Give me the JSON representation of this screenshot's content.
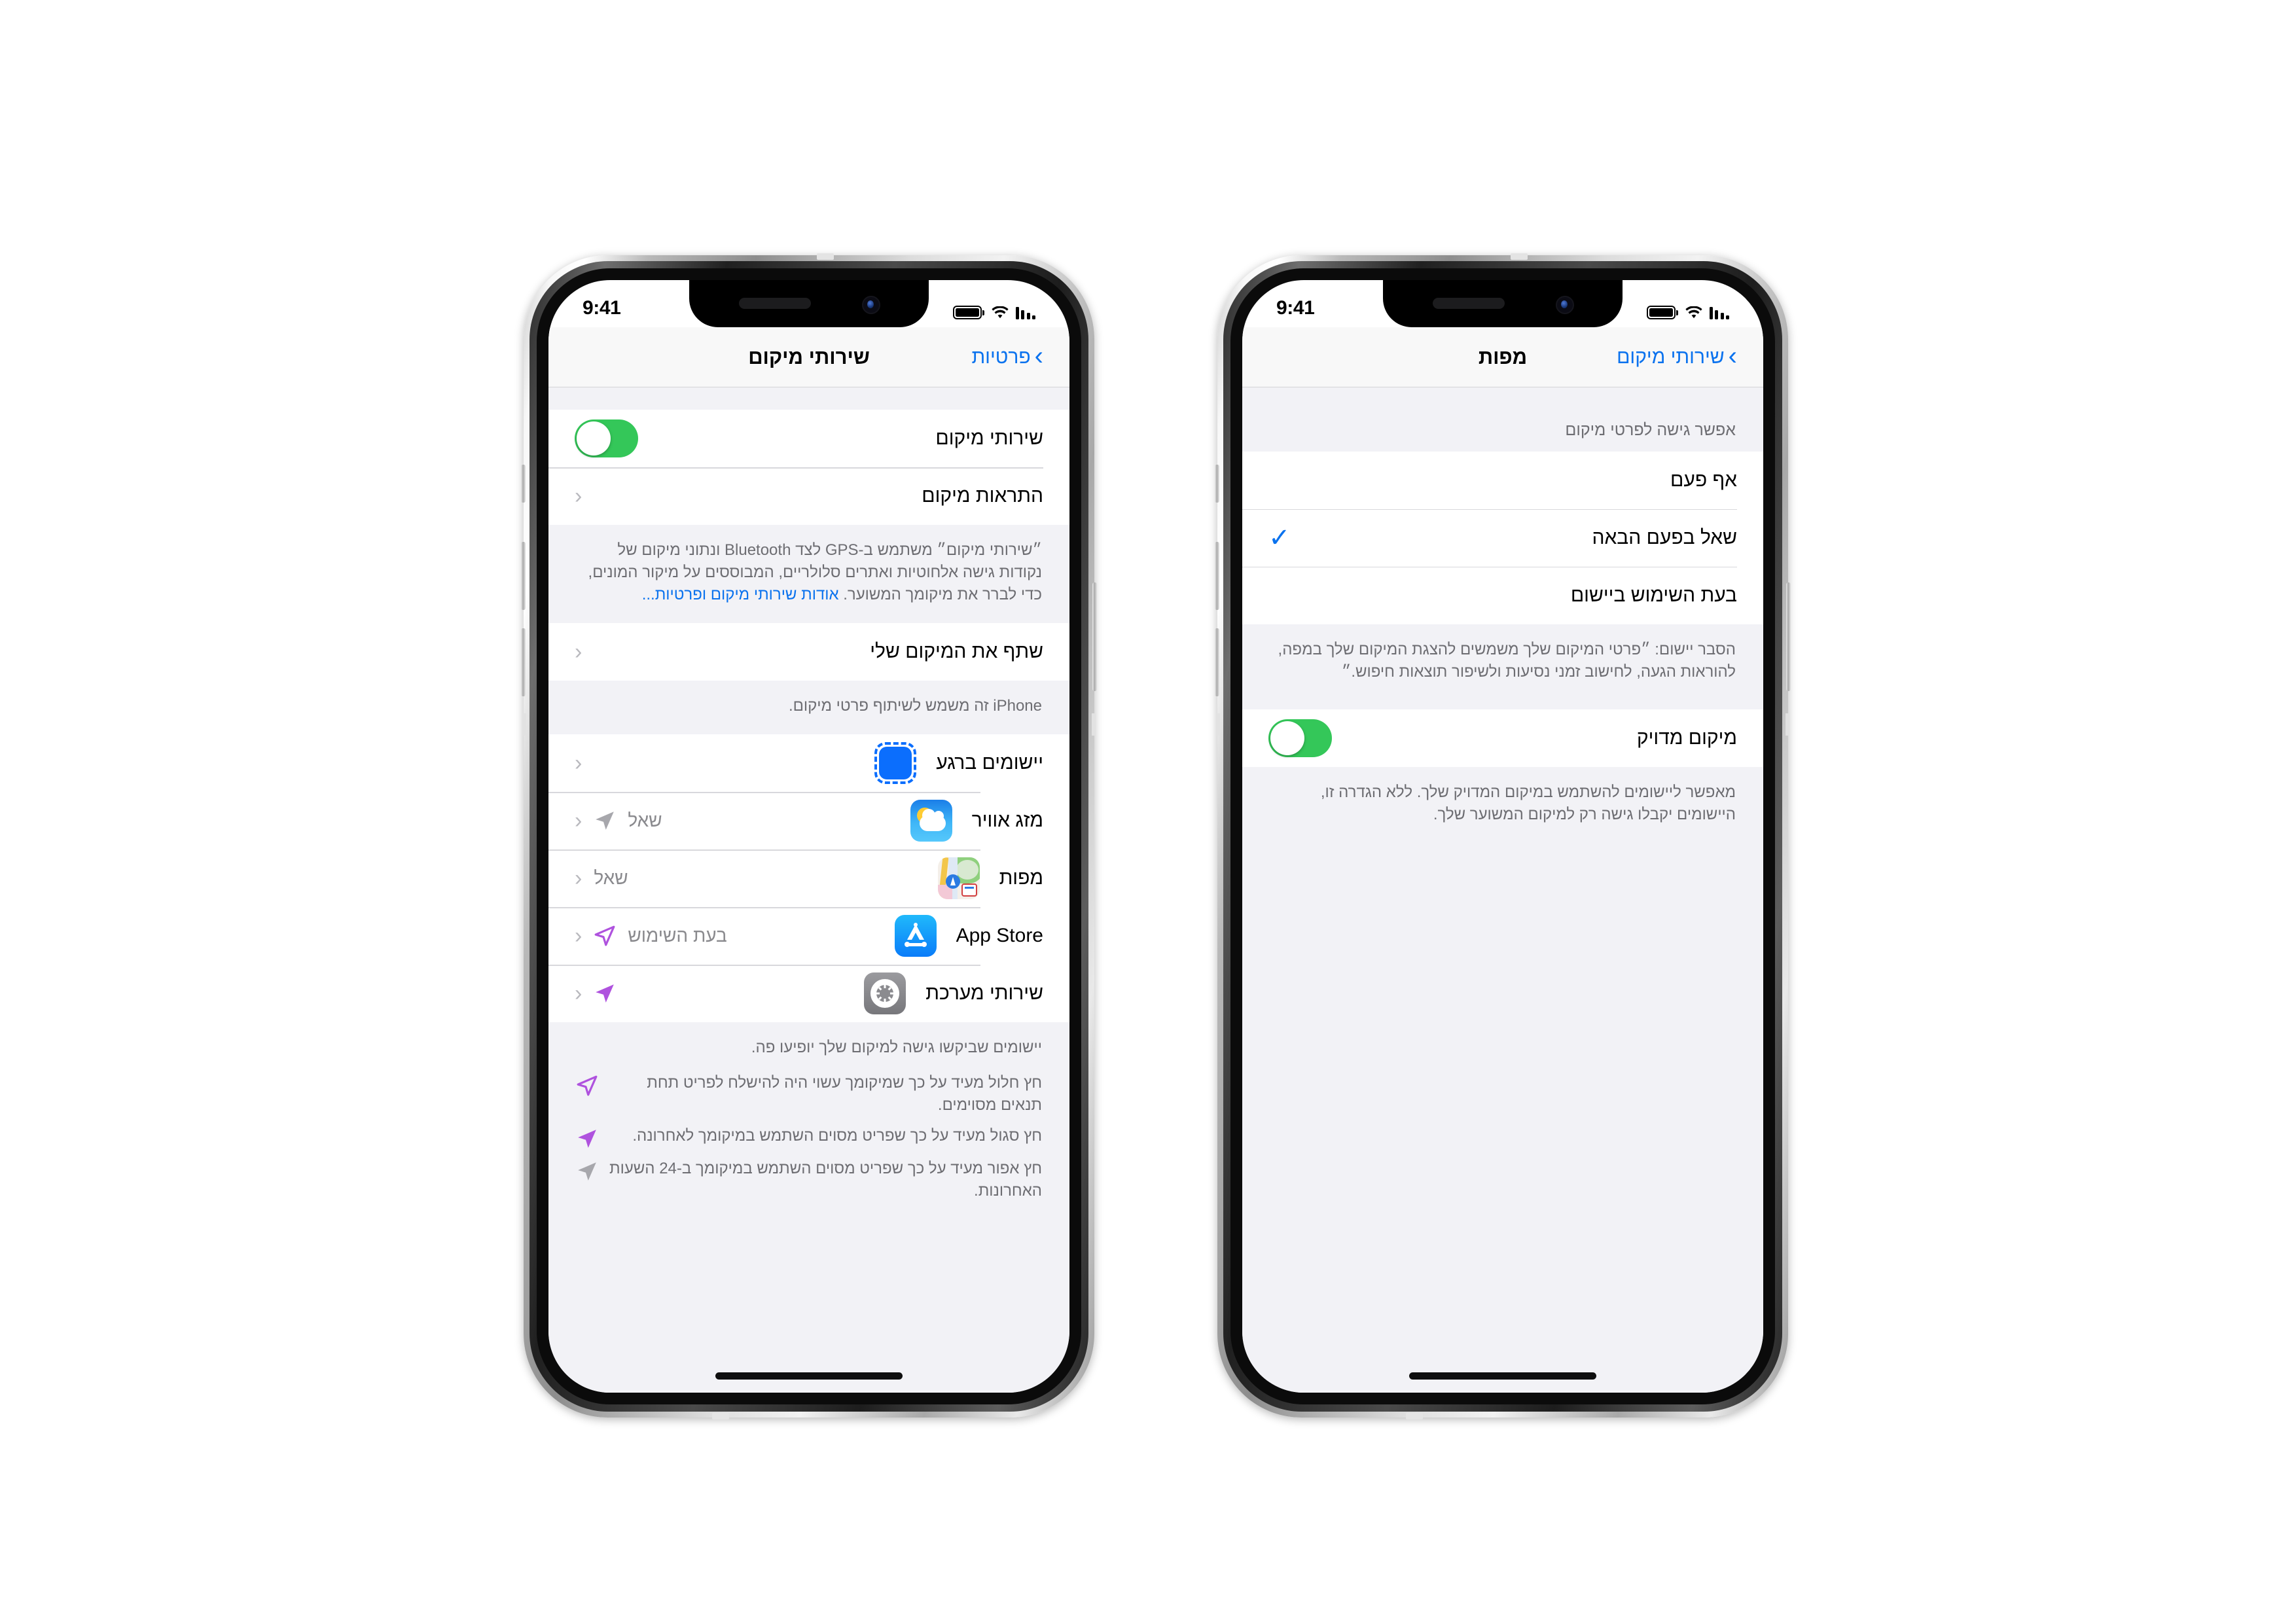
{
  "statusbar": {
    "time": "9:41",
    "battery_icon": "battery-full-icon",
    "wifi_icon": "wifi-icon",
    "cellular_icon": "cellular-signal-icon"
  },
  "phone_left": {
    "nav": {
      "back_label": "פרטיות",
      "title": "שירותי מיקום"
    },
    "location_services_row": {
      "label": "שירותי מיקום",
      "toggle_state": "on",
      "toggle_color": "#34c759"
    },
    "location_alerts_row": {
      "label": "התראות מיקום"
    },
    "description": {
      "text": "״שירותי מיקום״ משתמש ב-GPS לצד Bluetooth ונתוני מיקום של נקודות גישה אלחוטיות ואתרים סלולריים, המבוססים על מיקור המונים, כדי לברר את מיקומך המשוער. ",
      "link": "אודות שירותי מיקום ופרטיות...",
      "link_color": "#0a72ee"
    },
    "share_location_row": {
      "label": "שתף את המיקום שלי"
    },
    "share_location_footnote": "iPhone זה משמש לשיתוף פרטי מיקום.",
    "apps": [
      {
        "name": "יישומים ברגע",
        "value": "",
        "icon": "app-clips-icon",
        "arrow": "none"
      },
      {
        "name": "מזג אוויר",
        "value": "שאל",
        "icon": "weather-app-icon",
        "arrow": "gray"
      },
      {
        "name": "מפות",
        "value": "שאל",
        "icon": "maps-app-icon",
        "arrow": "none"
      },
      {
        "name": "App Store",
        "value": "בעת השימוש",
        "icon": "app-store-icon",
        "arrow": "purple-hollow"
      },
      {
        "name": "שירותי מערכת",
        "value": "",
        "icon": "settings-app-icon",
        "arrow": "purple-filled"
      }
    ],
    "footer": {
      "intro": "יישומים שביקשו גישה למיקום שלך יופיעו פה.",
      "legend": [
        {
          "arrow": "purple-hollow",
          "text": "חץ חלול מעיד על כך שמיקומך עשוי היה להישלח לפריט תחת תנאים מסוימים."
        },
        {
          "arrow": "purple-filled",
          "text": "חץ סגול מעיד על כך שפריט מסוים השתמש במיקומך לאחרונה."
        },
        {
          "arrow": "gray",
          "text": "חץ אפור מעיד על כך שפריט מסוים השתמש במיקומך ב-24 השעות האחרונות."
        }
      ]
    }
  },
  "phone_right": {
    "nav": {
      "back_label": "שירותי מיקום",
      "title": "מפות"
    },
    "section_header": "אפשר גישה לפרטי מיקום",
    "options": [
      {
        "label": "אף פעם",
        "selected": false
      },
      {
        "label": "שאל בפעם הבאה",
        "selected": true
      },
      {
        "label": "בעת השימוש ביישום",
        "selected": false
      }
    ],
    "purpose_note": "הסבר יישום: ״פרטי המיקום שלך משמשים להצגת המיקום שלך במפה, להוראות הגעה, לחישוב זמני נסיעות ולשיפור תוצאות חיפוש.״",
    "precise_row": {
      "label": "מיקום מדויק",
      "toggle_state": "on",
      "toggle_color": "#34c759"
    },
    "precise_footnote": "מאפשר ליישומים להשתמש במיקום המדויק שלך. ללא הגדרה זו, היישומים יקבלו גישה רק למיקום המשוער שלך."
  }
}
